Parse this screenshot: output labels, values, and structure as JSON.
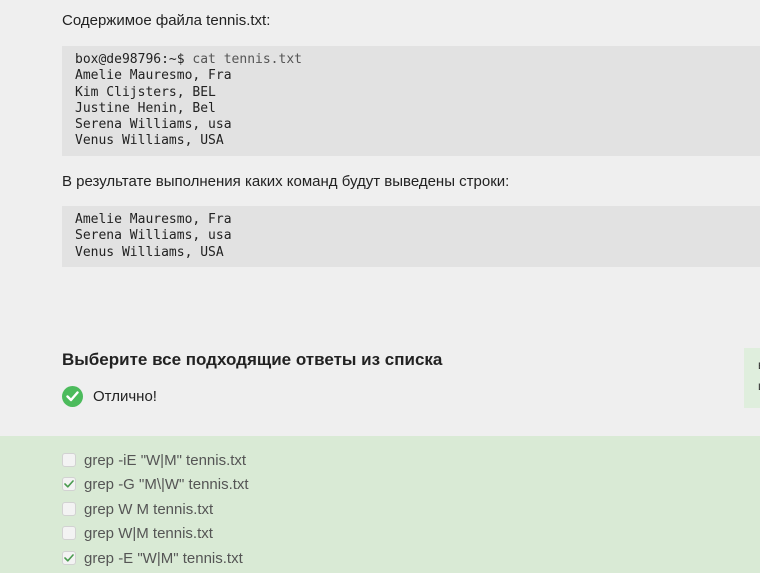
{
  "intro_text": "Содержимое файла tennis.txt:",
  "code_block_1": {
    "prompt": "box@de98796:~$",
    "command": " cat tennis.txt",
    "lines": [
      "Amelie Mauresmo, Fra",
      "Kim Clijsters, BEL",
      "Justine Henin, Bel",
      "Serena Williams, usa",
      "Venus Williams, USA"
    ]
  },
  "question_text": "В результате выполнения каких команд будут выведены строки:",
  "code_block_2": {
    "lines": [
      "Amelie Mauresmo, Fra",
      "Serena Williams, usa",
      "Venus Williams, USA"
    ]
  },
  "section_title": "Выберите все подходящие ответы из списка",
  "status": {
    "label": "Отлично!",
    "icon": "check-circle-icon",
    "color": "#4cbb5c"
  },
  "side_tab": {
    "letters": [
      "в",
      "ц"
    ]
  },
  "answers": [
    {
      "label": "grep -iE \"W|M\" tennis.txt",
      "checked": false
    },
    {
      "label": "grep -G \"M\\|W\" tennis.txt",
      "checked": true
    },
    {
      "label": "grep W M tennis.txt",
      "checked": false
    },
    {
      "label": "grep W|M tennis.txt",
      "checked": false
    },
    {
      "label": "grep -E \"W|M\" tennis.txt",
      "checked": true
    }
  ]
}
